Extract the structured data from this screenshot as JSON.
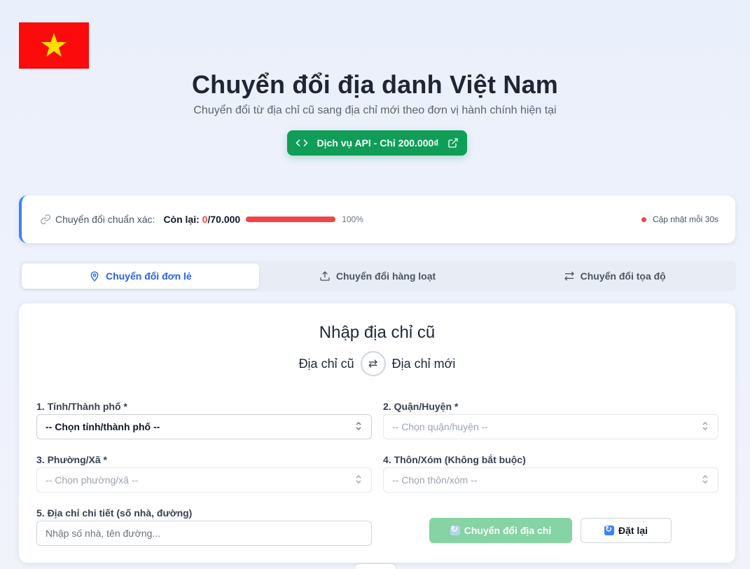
{
  "header": {
    "flag_colors": {
      "background": "#fb0b0b",
      "star": "#ffde00"
    },
    "title": "Chuyển đổi địa danh Việt Nam",
    "subtitle": "Chuyển đổi từ địa chỉ cũ sang địa chỉ mới theo đơn vị hành chính hiện tại",
    "api_button": {
      "label": "Dịch vụ API - Chỉ 200.000₫",
      "left_icon": "code-icon",
      "right_icon": "external-link-icon"
    }
  },
  "status": {
    "icon": "link-icon",
    "label": "Chuyển đổi chuẩn xác:",
    "remaining_prefix": "Còn lại: ",
    "remaining_used": "0",
    "remaining_total": "/70.000",
    "progress_percent": "100%",
    "progress_fraction": 1.0,
    "update_text": "Cập nhật mỗi 30s",
    "accent_color": "#3b82f6",
    "alert_color": "#ef4444"
  },
  "tabs": [
    {
      "label": "Chuyển đổi đơn lẻ",
      "icon": "map-pin-icon",
      "active": true
    },
    {
      "label": "Chuyển đổi hàng loạt",
      "icon": "upload-icon",
      "active": false
    },
    {
      "label": "Chuyển đổi tọa độ",
      "icon": "swap-arrows-icon",
      "active": false
    }
  ],
  "form": {
    "title": "Nhập địa chỉ cũ",
    "from_label": "Địa chỉ cũ",
    "to_label": "Địa chỉ mới",
    "swap_icon": "⇄",
    "fields": {
      "province": {
        "label": "1. Tỉnh/Thành phố *",
        "value": "-- Chọn tỉnh/thành phố --"
      },
      "district": {
        "label": "2. Quận/Huyện *",
        "value": "-- Chọn quận/huyện --"
      },
      "ward": {
        "label": "3. Phường/Xã *",
        "value": "-- Chọn phường/xã --"
      },
      "hamlet": {
        "label": "4. Thôn/Xóm (Không bắt buộc)",
        "value": "-- Chọn thôn/xóm --"
      },
      "detail": {
        "label": "5. Địa chỉ chi tiết (số nhà, đường)",
        "placeholder": "Nhập số nhà, tên đường..."
      }
    },
    "convert_button": "Chuyển đổi địa chỉ",
    "reset_button": "Đặt lại",
    "primary_color": "#0f9d58"
  }
}
